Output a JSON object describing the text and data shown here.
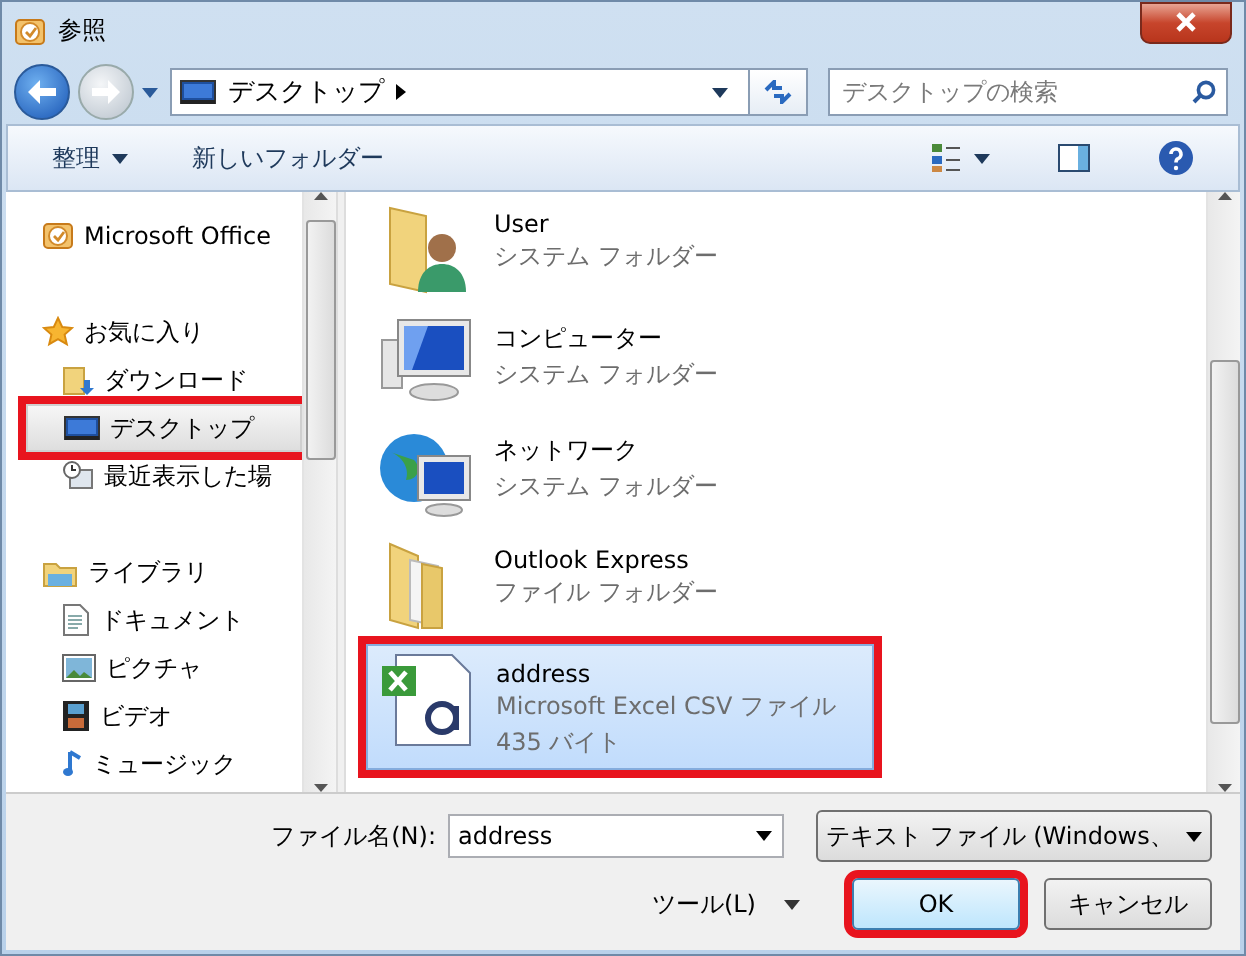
{
  "window": {
    "title": "参照"
  },
  "navigation": {
    "address": "デスクトップ",
    "search_placeholder": "デスクトップの検索"
  },
  "toolbar": {
    "organize": "整理",
    "new_folder": "新しいフォルダー"
  },
  "sidebar": {
    "items": [
      {
        "label": "Microsoft Office",
        "kind": "outlook",
        "selected": false,
        "highlighted": false
      },
      {
        "label": "お気に入り",
        "kind": "star",
        "selected": false,
        "highlighted": false,
        "children": [
          {
            "label": "ダウンロード",
            "kind": "download",
            "selected": false,
            "highlighted": false
          },
          {
            "label": "デスクトップ",
            "kind": "desktop",
            "selected": true,
            "highlighted": true
          },
          {
            "label": "最近表示した場",
            "kind": "recent",
            "selected": false,
            "highlighted": false
          }
        ]
      },
      {
        "label": "ライブラリ",
        "kind": "library",
        "selected": false,
        "highlighted": false,
        "children": [
          {
            "label": "ドキュメント",
            "kind": "document",
            "selected": false,
            "highlighted": false
          },
          {
            "label": "ピクチャ",
            "kind": "picture",
            "selected": false,
            "highlighted": false
          },
          {
            "label": "ビデオ",
            "kind": "video",
            "selected": false,
            "highlighted": false
          },
          {
            "label": "ミュージック",
            "kind": "music",
            "selected": false,
            "highlighted": false
          }
        ]
      }
    ]
  },
  "files": [
    {
      "name": "User",
      "type": "システム フォルダー",
      "kind": "user-folder",
      "selected": false,
      "highlighted": false
    },
    {
      "name": "コンピューター",
      "type": "システム フォルダー",
      "kind": "computer",
      "selected": false,
      "highlighted": false
    },
    {
      "name": "ネットワーク",
      "type": "システム フォルダー",
      "kind": "network",
      "selected": false,
      "highlighted": false
    },
    {
      "name": "Outlook Express",
      "type": "ファイル フォルダー",
      "kind": "folder",
      "selected": false,
      "highlighted": false
    },
    {
      "name": "address",
      "type": "Microsoft Excel CSV ファイル",
      "size": "435 バイト",
      "kind": "csv",
      "selected": true,
      "highlighted": true
    }
  ],
  "footer": {
    "filename_label": "ファイル名(N):",
    "filename": "address",
    "filetype": "テキスト ファイル (Windows、",
    "tools": "ツール(L)",
    "buttons": [
      {
        "label": "OK",
        "kind": "primary",
        "highlighted": true
      },
      {
        "label": "キャンセル",
        "kind": "normal",
        "highlighted": false
      }
    ]
  }
}
